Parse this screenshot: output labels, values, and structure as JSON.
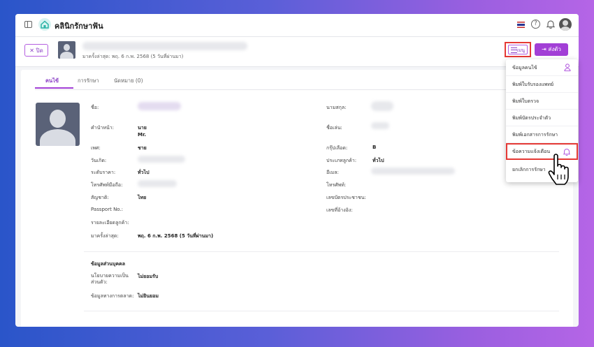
{
  "app": {
    "title": "คลินิกรักษาฟัน"
  },
  "topbar": {
    "flag_colors": [
      "#c62828",
      "#ffffff",
      "#283593"
    ],
    "help_glyph": "?"
  },
  "patient_bar": {
    "close_label": "ปิด",
    "last_visit": "มาครั้งล่าสุด: พฤ. 6 ก.พ. 2568 (5 วันที่ผ่านมา)",
    "menu_label": "เมนู",
    "send_label": "ส่งตัว"
  },
  "tabs": [
    {
      "label": "คนไข้",
      "active": true
    },
    {
      "label": "การรักษา",
      "active": false
    },
    {
      "label": "นัดหมาย (0)",
      "active": false
    }
  ],
  "fields_left": [
    {
      "label": "ชื่อ:",
      "value": ""
    },
    {
      "label": "คำนำหน้า:",
      "value": "นาย\nMr."
    },
    {
      "label": "เพศ:",
      "value": "ชาย"
    },
    {
      "label": "วันเกิด:",
      "value": ""
    },
    {
      "label": "ระดับราคา:",
      "value": "ทั่วไป"
    },
    {
      "label": "โทรศัพท์มือถือ:",
      "value": ""
    },
    {
      "label": "สัญชาติ:",
      "value": "ไทย"
    },
    {
      "label": "Passport No.:",
      "value": ""
    },
    {
      "label": "รายละเอียดลูกค้า:",
      "value": ""
    },
    {
      "label": "มาครั้งล่าสุด:",
      "value": "พฤ. 6 ก.พ. 2568 (5 วันที่ผ่านมา)"
    }
  ],
  "fields_right": [
    {
      "label": "นามสกุล:",
      "value": ""
    },
    {
      "label": "ชื่อเล่น:",
      "value": ""
    },
    {
      "label": "กรุ๊ปเลือด:",
      "value": "B"
    },
    {
      "label": "ประเภทลูกค้า:",
      "value": "ทั่วไป"
    },
    {
      "label": "อีเมล:",
      "value": ""
    },
    {
      "label": "โทรศัพท์:",
      "value": ""
    },
    {
      "label": "เลขบัตรประชาชน:",
      "value": ""
    },
    {
      "label": "เลขที่อ้างอิง:",
      "value": ""
    }
  ],
  "personal_section": {
    "title": "ข้อมูลส่วนบุคคล",
    "rows": [
      {
        "label": "นโยบายความเป็น\nส่วนตัว:",
        "value": "ไม่ยอมรับ"
      },
      {
        "label": "ข้อมูลทางการตลาด:",
        "value": "ไม่ยินยอม"
      }
    ]
  },
  "dropdown": {
    "items": [
      {
        "label": "ข้อมูลคนไข้",
        "icon": "person-icon"
      },
      {
        "label": "พิมพ์ใบรับรองแพทย์"
      },
      {
        "label": "พิมพ์ใบตรวจ"
      },
      {
        "label": "พิมพ์บัตรประจำตัว"
      },
      {
        "label": "พิมพ์เอกสารการรักษา"
      },
      {
        "label": "ข้อความแจ้งเตือน",
        "icon": "bell-icon",
        "highlighted": true
      },
      {
        "label": "ยกเลิกการรักษา"
      }
    ]
  },
  "colors": {
    "accent": "#a23fd6",
    "highlight": "#e53935",
    "teal": "#2bb3a6"
  }
}
